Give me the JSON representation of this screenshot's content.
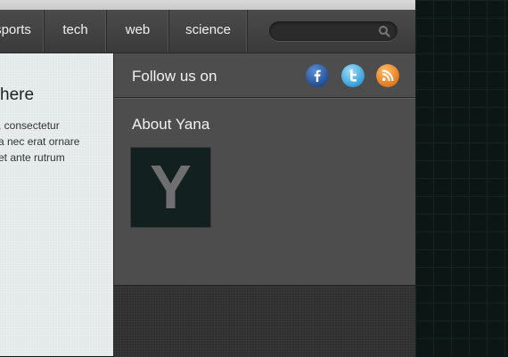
{
  "nav": {
    "items": [
      {
        "label": "sports"
      },
      {
        "label": "tech"
      },
      {
        "label": "web"
      },
      {
        "label": "science"
      }
    ],
    "search_placeholder": ""
  },
  "content": {
    "heading": "here",
    "text_lines": [
      ", consectetur",
      "a nec erat ornare",
      "et ante rutrum"
    ]
  },
  "sidebar": {
    "follow_label": "Follow us on",
    "social": [
      {
        "name": "facebook",
        "glyph": "f",
        "color": "#2c5aa0"
      },
      {
        "name": "twitter",
        "glyph": "t",
        "color": "#4fb0e3"
      },
      {
        "name": "rss",
        "glyph": "rss",
        "color": "#f08a2a"
      }
    ],
    "about_title": "About Yana",
    "avatar_letter": "Y"
  }
}
